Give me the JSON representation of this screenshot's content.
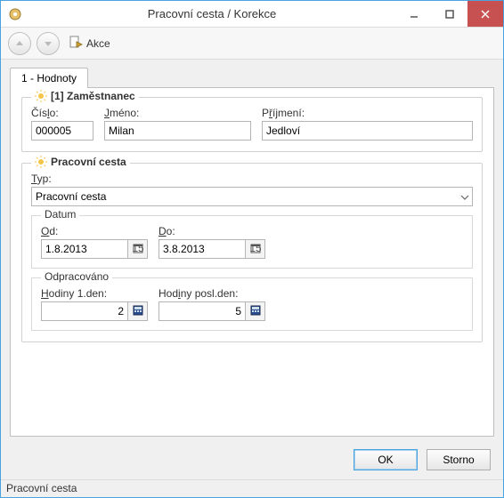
{
  "window": {
    "title": "Pracovní cesta / Korekce"
  },
  "toolbar": {
    "akce_label": "Akce"
  },
  "tabs": {
    "tab0": "1 - Hodnoty"
  },
  "group_employee": {
    "legend": "[1] Zaměstnanec",
    "cislo_label_pre": "Čís",
    "cislo_label_hot": "l",
    "cislo_label_post": "o:",
    "cislo_value": "000005",
    "jmeno_label_hot": "J",
    "jmeno_label_post": "méno:",
    "jmeno_value": "Milan",
    "prijmeni_label_pre": "P",
    "prijmeni_label_hot": "ř",
    "prijmeni_label_post": "íjmení:",
    "prijmeni_value": "Jedloví"
  },
  "group_trip": {
    "legend": "Pracovní cesta",
    "typ_label_hot": "T",
    "typ_label_post": "yp:",
    "typ_value": "Pracovní cesta",
    "datum_legend": "Datum",
    "od_label_hot": "O",
    "od_label_post": "d:",
    "od_value": "1.8.2013",
    "do_label_hot": "D",
    "do_label_post": "o:",
    "do_value": "3.8.2013",
    "odprac_legend": "Odpracováno",
    "h1_label_hot": "H",
    "h1_label_post": "odiny 1.den:",
    "h1_value": "2",
    "hp_label_pre": "Hod",
    "hp_label_hot": "i",
    "hp_label_post": "ny posl.den:",
    "hp_value": "5"
  },
  "buttons": {
    "ok": "OK",
    "cancel": "Storno"
  },
  "status": {
    "text": "Pracovní cesta"
  }
}
